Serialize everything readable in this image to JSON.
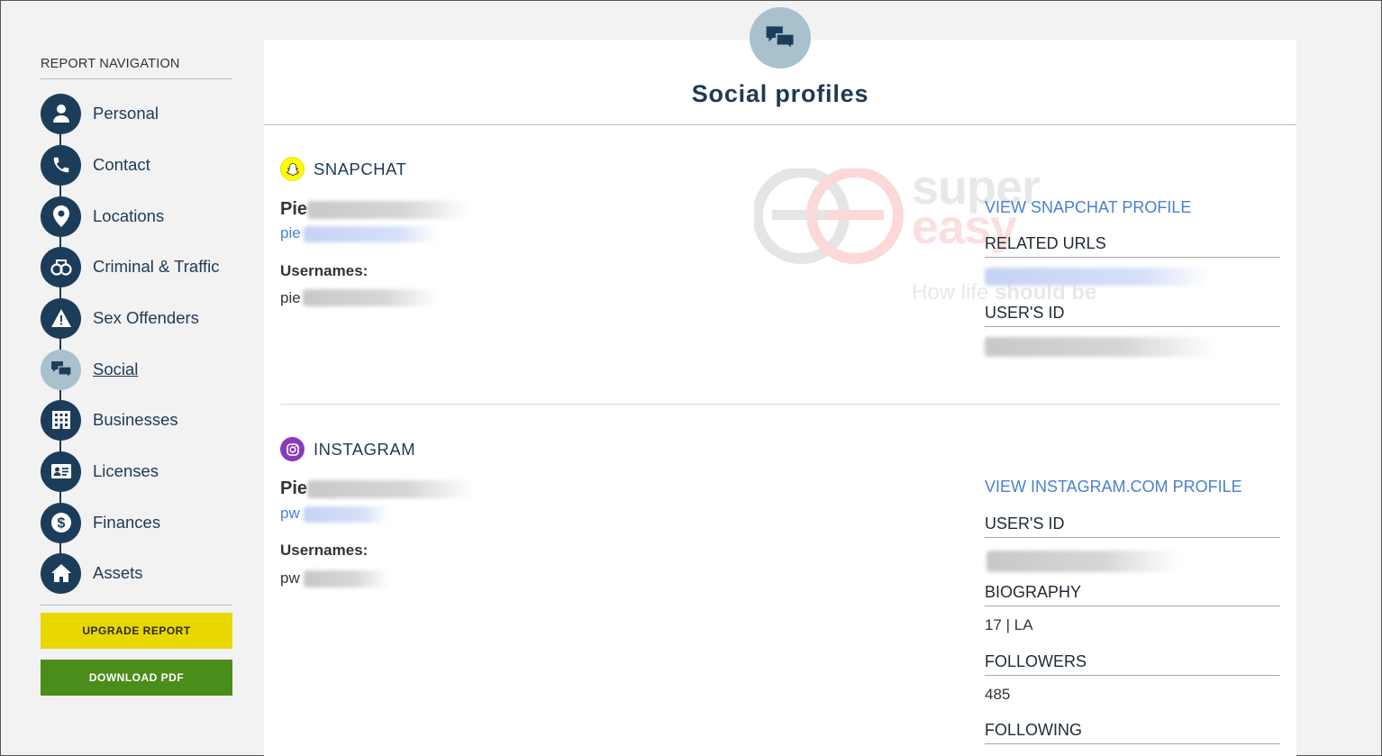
{
  "sidebar": {
    "heading": "REPORT NAVIGATION",
    "items": [
      {
        "label": "Personal",
        "icon": "person-icon"
      },
      {
        "label": "Contact",
        "icon": "phone-icon"
      },
      {
        "label": "Locations",
        "icon": "map-pin-icon"
      },
      {
        "label": "Criminal & Traffic",
        "icon": "handcuffs-icon"
      },
      {
        "label": "Sex Offenders",
        "icon": "warning-icon"
      },
      {
        "label": "Social",
        "icon": "chat-bubbles-icon",
        "active": true
      },
      {
        "label": "Businesses",
        "icon": "building-icon"
      },
      {
        "label": "Licenses",
        "icon": "id-card-icon"
      },
      {
        "label": "Finances",
        "icon": "dollar-icon"
      },
      {
        "label": "Assets",
        "icon": "house-icon"
      }
    ],
    "upgrade_label": "UPGRADE REPORT",
    "download_label": "DOWNLOAD PDF"
  },
  "main": {
    "title": "Social profiles",
    "header_icon": "chat-bubbles-icon"
  },
  "snapchat": {
    "platform": "SNAPCHAT",
    "name_prefix": "Pie",
    "link_prefix": "pie",
    "usernames_label": "Usernames:",
    "username_prefix": "pie",
    "view_link": "VIEW SNAPCHAT PROFILE",
    "related_urls_label": "RELATED URLS",
    "users_id_label": "USER'S ID"
  },
  "instagram": {
    "platform": "INSTAGRAM",
    "name_prefix": "Pie",
    "link_prefix": "pw",
    "usernames_label": "Usernames:",
    "username_prefix": "pw",
    "view_link": "VIEW INSTAGRAM.COM PROFILE",
    "users_id_label": "USER'S ID",
    "biography_label": "BIOGRAPHY",
    "biography_value": "17 | LA",
    "followers_label": "FOLLOWERS",
    "followers_value": "485",
    "following_label": "FOLLOWING"
  },
  "watermark": {
    "line1": "super",
    "line2": "easy",
    "tagline_prefix": "How life ",
    "tagline_bold": "should be"
  },
  "colors": {
    "navy": "#1c3d5a",
    "active_circle": "#a9c1cd",
    "link_blue": "#4a80d0",
    "upgrade_yellow": "#e9d800",
    "download_green": "#4b8d1a",
    "snapchat_yellow": "#fffc00",
    "instagram_purple": "#8a3ab9"
  }
}
